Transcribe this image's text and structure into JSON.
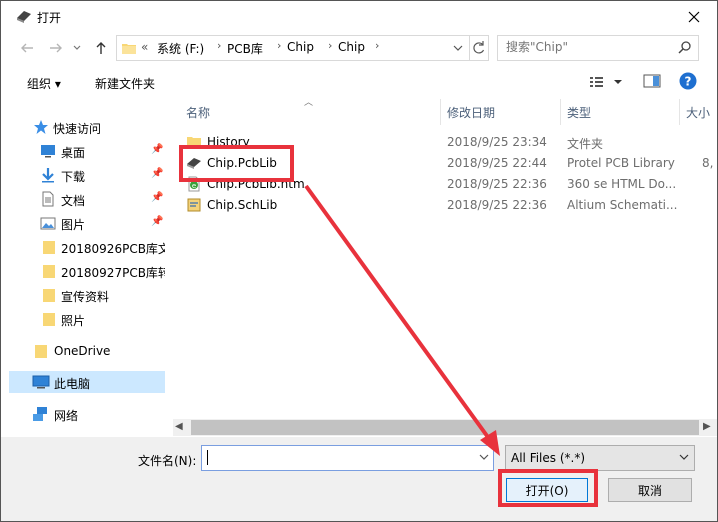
{
  "window": {
    "title": "打开"
  },
  "address": {
    "overflow": "«",
    "parts": [
      "系统 (F:)",
      "PCB库",
      "Chip",
      "Chip"
    ]
  },
  "search": {
    "placeholder": "搜索\"Chip\""
  },
  "toolbar": {
    "organize_label": "组织 ▾",
    "new_folder_label": "新建文件夹"
  },
  "sidebar": {
    "items": [
      {
        "label": "快速访问",
        "icon": "star-icon"
      },
      {
        "label": "桌面",
        "icon": "desktop-icon",
        "pinned": true
      },
      {
        "label": "下载",
        "icon": "download-icon",
        "pinned": true
      },
      {
        "label": "文档",
        "icon": "document-icon",
        "pinned": true
      },
      {
        "label": "图片",
        "icon": "pictures-icon",
        "pinned": true
      },
      {
        "label": "20180926PCB库文",
        "icon": "folder-icon"
      },
      {
        "label": "20180927PCB库转",
        "icon": "folder-icon"
      },
      {
        "label": "宣传资料",
        "icon": "folder-icon"
      },
      {
        "label": "照片",
        "icon": "folder-icon"
      },
      {
        "label": "OneDrive",
        "icon": "folder-icon"
      },
      {
        "label": "此电脑",
        "icon": "computer-icon",
        "selected": true
      },
      {
        "label": "网络",
        "icon": "network-icon"
      }
    ]
  },
  "filelist": {
    "columns": [
      "名称",
      "修改日期",
      "类型",
      "大小"
    ],
    "rows": [
      {
        "name": "History",
        "date": "2018/9/25 23:34",
        "type": "文件夹",
        "icon": "folder-icon"
      },
      {
        "name": "Chip.PcbLib",
        "date": "2018/9/25 22:44",
        "type": "Protel PCB Library",
        "size": "8,",
        "icon": "pcblib-icon"
      },
      {
        "name": "Chip.PcbLib.htm",
        "date": "2018/9/25 22:36",
        "type": "360 se HTML Do...",
        "icon": "html-icon"
      },
      {
        "name": "Chip.SchLib",
        "date": "2018/9/25 22:36",
        "type": "Altium Schemati...",
        "icon": "schlib-icon"
      }
    ]
  },
  "bottom": {
    "filename_label": "文件名(N):",
    "filename_value": "",
    "filter_value": "All Files (*.*)",
    "open_label": "打开(O)",
    "cancel_label": "取消"
  },
  "colors": {
    "annotation": "#e8323c",
    "selection": "#cce8ff",
    "accent": "#0078d7"
  }
}
